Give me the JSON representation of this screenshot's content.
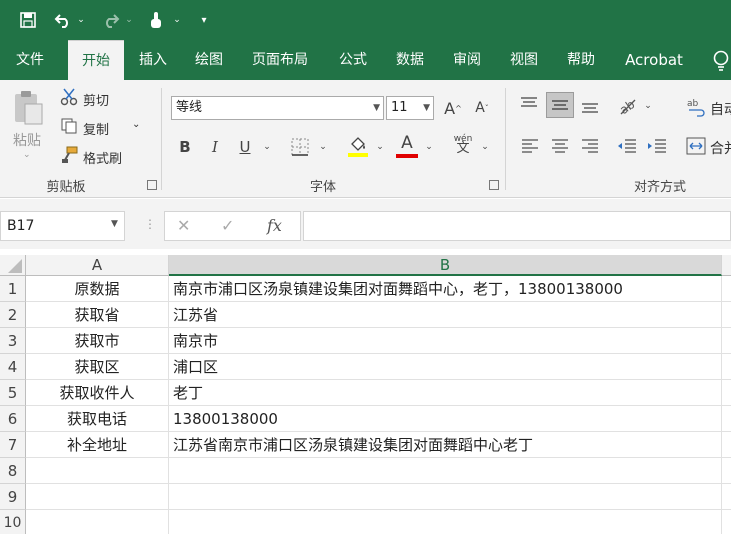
{
  "quick_access": {
    "save_icon": "save-icon",
    "undo_icon": "undo-icon",
    "redo_icon": "redo-icon",
    "touch_icon": "touch-mode-icon",
    "customize_icon": "customize-icon"
  },
  "tabs": [
    "文件",
    "开始",
    "插入",
    "绘图",
    "页面布局",
    "公式",
    "数据",
    "审阅",
    "视图",
    "帮助",
    "Acrobat"
  ],
  "active_tab": "开始",
  "clipboard": {
    "paste": "粘贴",
    "cut": "剪切",
    "copy": "复制",
    "format_painter": "格式刷",
    "group_label": "剪贴板"
  },
  "font": {
    "name": "等线",
    "size": "11",
    "grow_label": "A",
    "shrink_label": "A",
    "bold": "B",
    "italic": "I",
    "underline": "U",
    "font_color_letter": "A",
    "phonetic": "wén",
    "group_label": "字体"
  },
  "alignment": {
    "wrap_label": "自动",
    "merge_label": "合并",
    "group_label": "对齐方式"
  },
  "colors": {
    "brand": "#217346",
    "highlight": "#ffff00",
    "font_color": "#e00000"
  },
  "formula_bar": {
    "name_box": "B17",
    "fx": "fx",
    "cancel": "✕",
    "enter": "✓",
    "content": ""
  },
  "grid": {
    "columns": [
      "A",
      "B"
    ],
    "rows": [
      {
        "num": "1",
        "a": "原数据",
        "b": "南京市浦口区汤泉镇建设集团对面舞蹈中心，老丁，13800138000"
      },
      {
        "num": "2",
        "a": "获取省",
        "b": "江苏省"
      },
      {
        "num": "3",
        "a": "获取市",
        "b": "南京市"
      },
      {
        "num": "4",
        "a": "获取区",
        "b": "浦口区"
      },
      {
        "num": "5",
        "a": "获取收件人",
        "b": "老丁"
      },
      {
        "num": "6",
        "a": "获取电话",
        "b": "13800138000"
      },
      {
        "num": "7",
        "a": "补全地址",
        "b": "江苏省南京市浦口区汤泉镇建设集团对面舞蹈中心老丁"
      },
      {
        "num": "8",
        "a": "",
        "b": ""
      },
      {
        "num": "9",
        "a": "",
        "b": ""
      },
      {
        "num": "10",
        "a": "",
        "b": ""
      }
    ]
  }
}
